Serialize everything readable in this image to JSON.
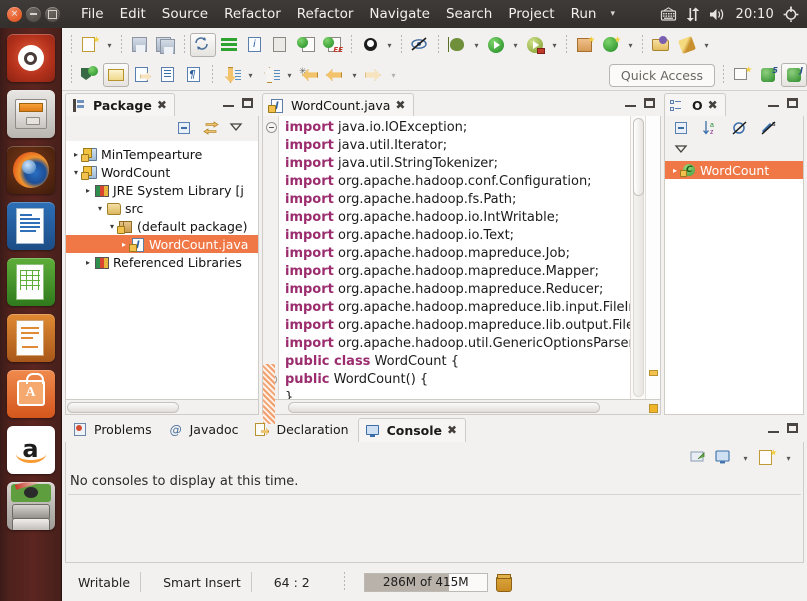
{
  "panel": {
    "window_controls": [
      "close",
      "minimize",
      "maximize"
    ],
    "menus": [
      "File",
      "Edit",
      "Source",
      "Refactor",
      "Refactor",
      "Navigate",
      "Search",
      "Project",
      "Run"
    ],
    "menu_overflow_caret": "▾",
    "tray_icons": [
      "keyboard-icon",
      "network-icon",
      "volume-icon",
      "power-icon"
    ],
    "clock": "20:10"
  },
  "launcher": {
    "items": [
      {
        "name": "ubuntu-dash",
        "label": "Ubuntu Dash"
      },
      {
        "name": "files",
        "label": "Files"
      },
      {
        "name": "firefox",
        "label": "Firefox Web Browser"
      },
      {
        "name": "libreoffice-writer",
        "label": "LibreOffice Writer"
      },
      {
        "name": "libreoffice-calc",
        "label": "LibreOffice Calc"
      },
      {
        "name": "libreoffice-impress",
        "label": "LibreOffice Impress"
      },
      {
        "name": "ubuntu-software",
        "label": "Ubuntu Software Center"
      },
      {
        "name": "amazon",
        "label": "Amazon"
      },
      {
        "name": "system-settings",
        "label": "System Settings"
      }
    ],
    "amazon_letter": "a"
  },
  "toolbar": {
    "quick_access_label": "Quick Access",
    "row1": [
      "new-wizard-icon",
      "new-wizard-dropdown",
      "save-icon",
      "save-all-icon",
      "refresh-icon",
      "properties-icon",
      "skip-breakpoints-icon",
      "annotation-icon",
      "run-last-tool-icon",
      "external-tools-icon",
      "open-type-icon",
      "open-type-dropdown",
      "unlink-icon",
      "debug-icon",
      "debug-dropdown",
      "run-icon",
      "run-dropdown",
      "run-config-icon",
      "run-config-dropdown",
      "new-java-project-icon",
      "new-class-icon",
      "new-class-dropdown",
      "open-package-icon",
      "search-icon",
      "search-dropdown"
    ],
    "row2": [
      "toggle-mark-occurrences-icon",
      "pencil-icon",
      "open-declaration-icon",
      "toggle-block-selection-icon",
      "show-whitespace-icon",
      "next-annotation-icon",
      "next-annotation-dropdown",
      "previous-annotation-icon",
      "previous-annotation-dropdown",
      "last-edit-location-icon",
      "back-icon",
      "back-dropdown",
      "forward-icon",
      "forward-dropdown"
    ],
    "perspective": [
      "open-perspective-icon",
      "java-perspective-5-icon",
      "java-perspective-j-icon"
    ]
  },
  "package_explorer": {
    "tab_label": "Package",
    "tab_close": "✖",
    "toolbar_icons": [
      "collapse-all-icon",
      "link-with-editor-icon",
      "view-menu-icon"
    ],
    "minimize_icon": "minimize-icon",
    "maximize_icon": "maximize-icon",
    "tree": [
      {
        "label": "MinTempearture",
        "indent": 0,
        "arrow": "▸",
        "icon": "java-project-icon",
        "selected": false
      },
      {
        "label": "WordCount",
        "indent": 0,
        "arrow": "▾",
        "icon": "java-project-icon",
        "selected": false
      },
      {
        "label": "JRE System Library [j",
        "indent": 1,
        "arrow": "▸",
        "icon": "library-icon",
        "selected": false
      },
      {
        "label": "src",
        "indent": 1,
        "arrow": "▾",
        "icon": "source-folder-icon",
        "selected": false
      },
      {
        "label": "(default package)",
        "indent": 2,
        "arrow": "▾",
        "icon": "package-icon",
        "selected": false
      },
      {
        "label": "WordCount.java",
        "indent": 3,
        "arrow": "▸",
        "icon": "java-file-icon",
        "selected": true
      },
      {
        "label": "Referenced Libraries",
        "indent": 1,
        "arrow": "▸",
        "icon": "library-icon",
        "selected": false
      }
    ]
  },
  "editor": {
    "tab_label": "WordCount.java",
    "tab_close": "✖",
    "tab_icon": "java-file-warning-icon",
    "minimize_icon": "minimize-icon",
    "maximize_icon": "maximize-icon",
    "lines": [
      {
        "kw": "import",
        "rest": " java.io.IOException;",
        "fold": true
      },
      {
        "kw": "import",
        "rest": " java.util.Iterator;",
        "fold": false
      },
      {
        "kw": "import",
        "rest": " java.util.StringTokenizer;",
        "fold": false
      },
      {
        "kw": "import",
        "rest": " org.apache.hadoop.conf.Configuration;",
        "fold": false
      },
      {
        "kw": "import",
        "rest": " org.apache.hadoop.fs.Path;",
        "fold": false
      },
      {
        "kw": "import",
        "rest": " org.apache.hadoop.io.IntWritable;",
        "fold": false
      },
      {
        "kw": "import",
        "rest": " org.apache.hadoop.io.Text;",
        "fold": false
      },
      {
        "kw": "import",
        "rest": " org.apache.hadoop.mapreduce.Job;",
        "fold": false
      },
      {
        "kw": "import",
        "rest": " org.apache.hadoop.mapreduce.Mapper;",
        "fold": false
      },
      {
        "kw": "import",
        "rest": " org.apache.hadoop.mapreduce.Reducer;",
        "fold": false
      },
      {
        "kw": "import",
        "rest": " org.apache.hadoop.mapreduce.lib.input.FileInput",
        "fold": false
      },
      {
        "kw": "import",
        "rest": " org.apache.hadoop.mapreduce.lib.output.FileOu",
        "fold": false
      },
      {
        "kw": "import",
        "rest": " org.apache.hadoop.util.GenericOptionsParser;",
        "fold": false
      },
      {
        "kw": "public class",
        "rest": " WordCount {",
        "fold": false
      },
      {
        "kw": "  public",
        "rest": " WordCount() {",
        "fold": true
      },
      {
        "kw": "",
        "rest": "  }",
        "fold": false
      }
    ]
  },
  "outline": {
    "tab_label": "O",
    "tab_close": "✖",
    "tab_icon": "outline-icon",
    "toolbar_icons": [
      "collapse-all-icon",
      "sort-icon",
      "hide-fields-icon",
      "hide-static-icon",
      "view-menu-icon"
    ],
    "minimize_icon": "minimize-icon",
    "maximize_icon": "maximize-icon",
    "items": [
      {
        "label": "WordCount",
        "arrow": "▸",
        "icon": "class-icon",
        "selected": true
      }
    ]
  },
  "bottom_panel": {
    "tabs": [
      {
        "label": "Problems",
        "icon": "problems-icon",
        "active": false
      },
      {
        "label": "Javadoc",
        "icon": "javadoc-icon",
        "active": false
      },
      {
        "label": "Declaration",
        "icon": "declaration-icon",
        "active": false
      },
      {
        "label": "Console",
        "icon": "console-icon",
        "active": true
      }
    ],
    "console_close": "✖",
    "message": "No consoles to display at this time.",
    "toolbar_icons": [
      "open-console-icon",
      "display-selected-console-icon",
      "display-dropdown",
      "new-console-view-icon",
      "new-console-dropdown"
    ],
    "minimize_icon": "minimize-icon",
    "maximize_icon": "maximize-icon"
  },
  "status_bar": {
    "writable": "Writable",
    "insert_mode": "Smart Insert",
    "position": "64 : 2",
    "heap": "286M of 415M",
    "heap_percent": 69,
    "trash_icon": "trash-icon"
  },
  "colors": {
    "selection": "#f07746",
    "keyword": "#9b2d6f",
    "panel_bg": "#332f2c",
    "launcher_bg": "#5c2520",
    "chrome_bg": "#f2f1f0"
  }
}
